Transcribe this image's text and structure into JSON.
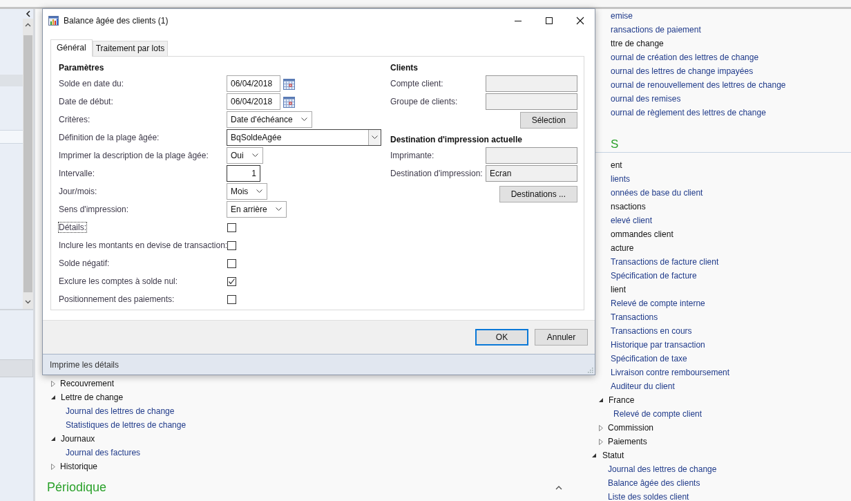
{
  "background": {
    "left_tree": [
      {
        "label": "Recouvrement",
        "kind": "group",
        "expanded": false
      },
      {
        "label": "Lettre de change",
        "kind": "group",
        "expanded": true,
        "children": [
          {
            "label": "Journal des lettres de change",
            "kind": "link"
          },
          {
            "label": "Statistiques de lettres de change",
            "kind": "link"
          }
        ]
      },
      {
        "label": "Journaux",
        "kind": "group",
        "expanded": true,
        "children": [
          {
            "label": "Journal des factures",
            "kind": "link"
          }
        ]
      },
      {
        "label": "Historique",
        "kind": "group",
        "expanded": false
      }
    ],
    "left_section": {
      "title": "Périodique",
      "expanded": true
    },
    "right_clipped": [
      {
        "text": "emise",
        "kind": "link"
      },
      {
        "text": "ransactions de paiement",
        "kind": "link"
      },
      {
        "text": "ttre de change",
        "kind": "group"
      },
      {
        "text": "ournal de création des lettres de change",
        "kind": "link"
      },
      {
        "text": "ournal des lettres de change impayées",
        "kind": "link"
      },
      {
        "text": "ournal de renouvellement des lettres de change",
        "kind": "link"
      },
      {
        "text": "ournal des remises",
        "kind": "link"
      },
      {
        "text": "ournal de règlement des lettres de change",
        "kind": "link"
      },
      {
        "text": "S",
        "kind": "section"
      },
      {
        "text": "ent",
        "kind": "group"
      },
      {
        "text": "lients",
        "kind": "link"
      },
      {
        "text": "onnées de base du client",
        "kind": "link"
      },
      {
        "text": "nsactions",
        "kind": "group"
      },
      {
        "text": "elevé client",
        "kind": "link"
      },
      {
        "text": "ommandes client",
        "kind": "group"
      },
      {
        "text": "acture",
        "kind": "group"
      },
      {
        "text": "Transactions de facture client",
        "kind": "link"
      },
      {
        "text": "Spécification de facture",
        "kind": "link"
      },
      {
        "text": "lient",
        "kind": "group"
      },
      {
        "text": "Relevé de compte interne",
        "kind": "link"
      },
      {
        "text": "Transactions",
        "kind": "link"
      },
      {
        "text": "Transactions en cours",
        "kind": "link"
      },
      {
        "text": "Historique par transaction",
        "kind": "link"
      },
      {
        "text": "Spécification de taxe",
        "kind": "link"
      },
      {
        "text": "Livraison contre remboursement",
        "kind": "link"
      },
      {
        "text": "Auditeur du client",
        "kind": "link"
      }
    ],
    "right_subgroups": [
      {
        "label": "France",
        "kind": "group",
        "expanded": true,
        "children": [
          {
            "label": "Relevé de compte client",
            "kind": "link"
          }
        ]
      },
      {
        "label": "Commission",
        "kind": "group",
        "expanded": false
      },
      {
        "label": "Paiements",
        "kind": "group",
        "expanded": false
      }
    ],
    "right_groups": [
      {
        "label": "Statut",
        "kind": "group",
        "expanded": true,
        "children": [
          {
            "label": "Journal des lettres de change",
            "kind": "link"
          },
          {
            "label": "Balance âgée des clients",
            "kind": "link"
          },
          {
            "label": "Liste des soldes client",
            "kind": "link"
          }
        ]
      }
    ]
  },
  "dialog": {
    "title": "Balance âgée des clients (1)",
    "tabs": [
      {
        "label": "Général",
        "selected": true
      },
      {
        "label": "Traitement par lots",
        "selected": false
      }
    ],
    "parameters": {
      "heading": "Paramètres",
      "rows": [
        {
          "label": "Solde en date du:",
          "kind": "date",
          "value": "06/04/2018"
        },
        {
          "label": "Date de début:",
          "kind": "date",
          "value": "06/04/2018"
        },
        {
          "label": "Critères:",
          "kind": "select",
          "value": "Date d'échéance"
        },
        {
          "label": "Définition de la plage âgée:",
          "kind": "combo",
          "value": "BqSoldeAgée"
        },
        {
          "label": "Imprimer la description de la plage âgée:",
          "kind": "select",
          "value": "Oui"
        },
        {
          "label": "Intervalle:",
          "kind": "number",
          "value": "1"
        },
        {
          "label": "Jour/mois:",
          "kind": "select",
          "value": "Mois"
        },
        {
          "label": "Sens d'impression:",
          "kind": "select",
          "value": "En arrière"
        },
        {
          "label": "Détails:",
          "kind": "checkbox",
          "checked": false,
          "focused": true
        },
        {
          "label": "Inclure les montants en devise de transaction:",
          "kind": "checkbox",
          "checked": false,
          "focused": false
        },
        {
          "label": "Solde négatif:",
          "kind": "checkbox",
          "checked": false,
          "focused": false
        },
        {
          "label": "Exclure les comptes à solde nul:",
          "kind": "checkbox",
          "checked": true,
          "focused": false
        },
        {
          "label": "Positionnement des paiements:",
          "kind": "checkbox",
          "checked": false,
          "focused": false
        }
      ]
    },
    "sections": [
      {
        "heading": "Clients",
        "fields": [
          {
            "label": "Compte client:"
          },
          {
            "label": "Groupe de clients:"
          }
        ],
        "button": "Sélection"
      },
      {
        "heading": "Destination d'impression actuelle",
        "fields": [
          {
            "label": "Imprimante:"
          },
          {
            "label": "Destination d'impression:",
            "value": "Ecran"
          }
        ],
        "button": "Destinations ..."
      }
    ],
    "buttons": [
      {
        "label": "OK",
        "default": true
      },
      {
        "label": "Annuler",
        "default": false
      }
    ],
    "status_bar": "Imprime les détails"
  }
}
